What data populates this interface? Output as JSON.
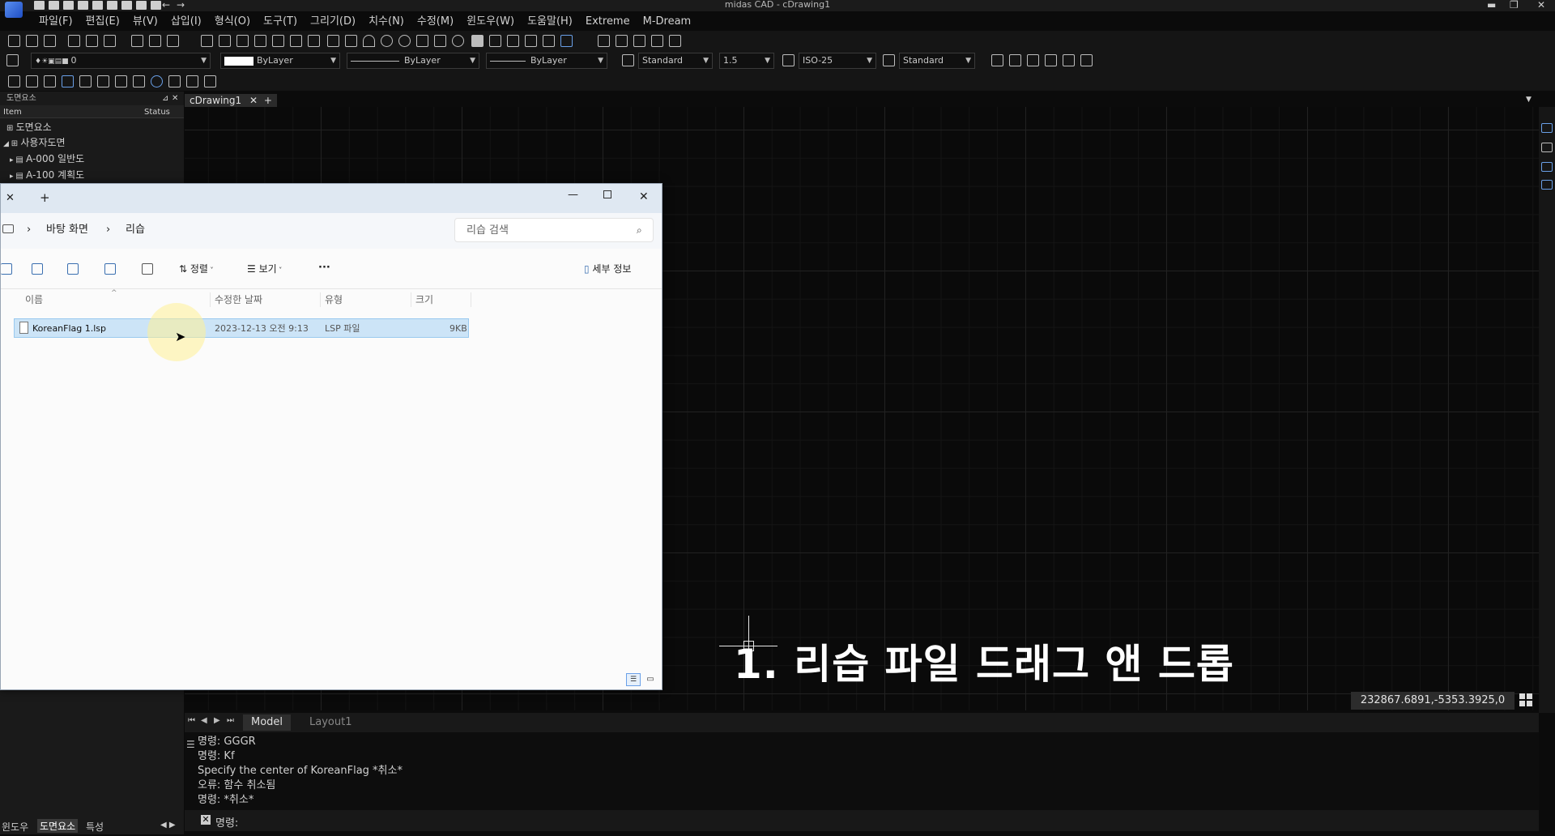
{
  "window": {
    "title": "midas CAD - cDrawing1"
  },
  "menu": [
    "파일(F)",
    "편집(E)",
    "뷰(V)",
    "삽입(I)",
    "형식(O)",
    "도구(T)",
    "그리기(D)",
    "치수(N)",
    "수정(M)",
    "윈도우(W)",
    "도움말(H)",
    "Extreme",
    "M-Dream"
  ],
  "toolbar": {
    "layer": "0",
    "color": "ByLayer",
    "linetype": "ByLayer",
    "lineweight": "ByLayer",
    "textstyle": "Standard",
    "textsize": "1.5",
    "dimstyle": "ISO-25",
    "mleaderstyle": "Standard"
  },
  "leftpanel": {
    "title": "도면요소",
    "col_item": "Item",
    "col_status": "Status",
    "tree": [
      "도면요소",
      "사용자도면",
      "A-000 일반도",
      "A-100 계획도"
    ],
    "bottom_tabs": [
      "윈도우",
      "도면요소",
      "특성"
    ]
  },
  "doc_tab": "cDrawing1",
  "explorer": {
    "breadcrumb": [
      "바탕 화면",
      "리습"
    ],
    "search_placeholder": "리습 검색",
    "sort_label": "정렬",
    "view_label": "보기",
    "more_label": "···",
    "details_label": "세부 정보",
    "columns": [
      "이름",
      "수정한 날짜",
      "유형",
      "크기"
    ],
    "files": [
      {
        "name": "KoreanFlag 1.lsp",
        "modified": "2023-12-13 오전 9:13",
        "type": "LSP 파일",
        "size": "9KB"
      }
    ]
  },
  "layout_tabs": [
    "Model",
    "Layout1"
  ],
  "command_history": [
    "명령: GGGR",
    "명령: Kf",
    "Specify the center of KoreanFlag *취소*",
    "오류: 함수 취소됨",
    "명령: *취소*"
  ],
  "command_prompt": "명령:",
  "coords": "232867.6891,-5353.3925,0",
  "caption": "1. 리습 파일 드래그 앤 드롭"
}
